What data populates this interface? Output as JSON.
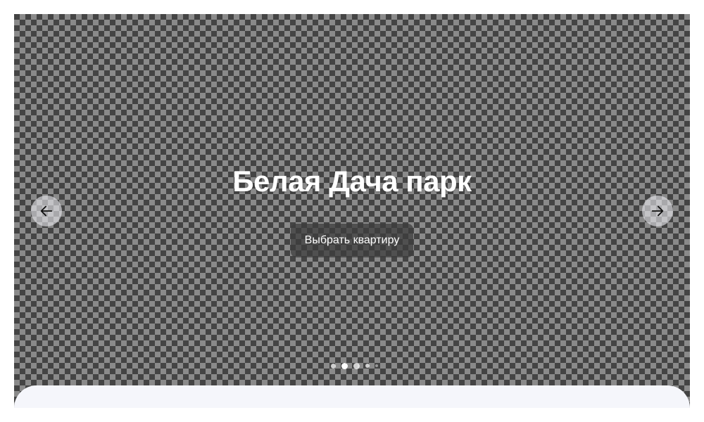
{
  "slide": {
    "title": "Белая Дача парк",
    "cta_label": "Выбрать квартиру"
  },
  "navigation": {
    "prev_icon": "arrow-left-icon",
    "next_icon": "arrow-right-icon"
  },
  "pagination": {
    "total_dots": 5,
    "active_index": 1
  },
  "colors": {
    "title": "#ffffff",
    "cta_background": "#3c3c3c",
    "bottom_panel": "#f5f6fb",
    "arrow_background": "#ebebf0"
  }
}
